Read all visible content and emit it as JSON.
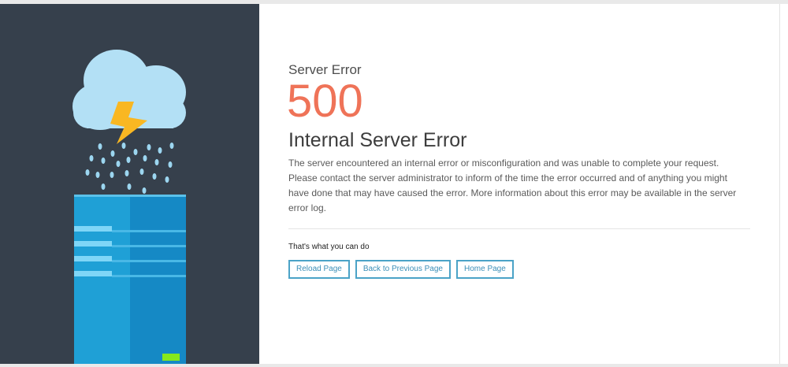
{
  "header": {
    "kicker": "Server Error",
    "code": "500",
    "title": "Internal Server Error"
  },
  "message": "The server encountered an internal error or misconfiguration and was unable to complete your request. Please contact the server administrator to inform of the time the error occurred and of anything you might have done that may have caused the error. More information about this error may be available in the server error log.",
  "actions": {
    "label": "That's what you can do",
    "buttons": [
      {
        "label": "Reload Page"
      },
      {
        "label": "Back to Previous Page"
      },
      {
        "label": "Home Page"
      }
    ]
  },
  "illustration": {
    "icons": [
      "cloud-icon",
      "lightning-icon",
      "rain-icon",
      "server-icon"
    ],
    "colors": {
      "panel": "#36404c",
      "cloud": "#b3e0f5",
      "bolt": "#f9b722",
      "rain": "#9cd6f0",
      "server_light": "#1fa0d6",
      "server_dark": "#1589c5",
      "indicator": "#86e81c"
    }
  },
  "colors": {
    "accent": "#ef7358",
    "button": "#4ba3c7"
  }
}
